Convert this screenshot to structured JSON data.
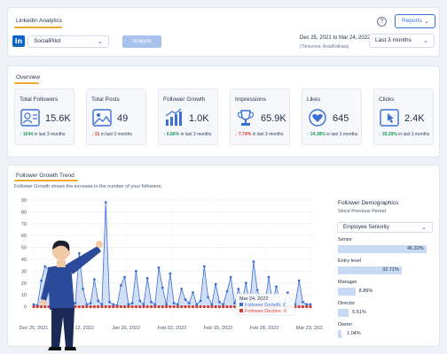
{
  "header": {
    "title": "LinkedIn Analytics",
    "account": "SocialPilot",
    "analyze_label": "Analyze",
    "date_range": "Dec 25, 2021 to Mar 24, 2022",
    "timezone": "(Timezone: Asia/Kolkata)",
    "period": "Last 3 months",
    "help": "?",
    "reports_label": "Reports"
  },
  "overview": {
    "title": "Overview",
    "metrics": [
      {
        "label": "Total Followers",
        "value": "15.6K",
        "change": "1044",
        "direction": "up",
        "suffix": "in last 3 months",
        "icon": "followers-icon"
      },
      {
        "label": "Total Posts",
        "value": "49",
        "change": "31",
        "direction": "down",
        "suffix": "in last 3 months",
        "icon": "image-icon"
      },
      {
        "label": "Follower Growth",
        "value": "1.0K",
        "change": "6.86%",
        "direction": "up",
        "suffix": "in last 3 months",
        "icon": "growth-icon"
      },
      {
        "label": "Impressions",
        "value": "65.9K",
        "change": "7.74%",
        "direction": "down",
        "suffix": "in last 3 months",
        "icon": "trophy-icon"
      },
      {
        "label": "Likes",
        "value": "645",
        "change": "34.38%",
        "direction": "up",
        "suffix": "in last 3 months",
        "icon": "heart-icon"
      },
      {
        "label": "Clicks",
        "value": "2.4K",
        "change": "39.29%",
        "direction": "up",
        "suffix": "in last 3 months",
        "icon": "click-icon"
      }
    ]
  },
  "trend": {
    "title": "Follower Growth Trend",
    "subtitle": "Follower Growth shows the increase in the number of your followers.",
    "tooltip": {
      "date": "Mar 24, 2022",
      "growth_label": "Follower Growth: 2",
      "decline_label": "Follower Decline: 0"
    }
  },
  "chart_data": {
    "type": "area",
    "x_ticks": [
      "Dec 25, 2021",
      "Jan 12, 2022",
      "Jan 26, 2022",
      "Feb 02, 2022",
      "Feb 15, 2022",
      "Feb 28, 2022",
      "Mar 23, 2022"
    ],
    "ylim": [
      -10,
      90
    ],
    "y_ticks": [
      0,
      10,
      20,
      30,
      40,
      50,
      60,
      70,
      80,
      90
    ],
    "grid": true,
    "series": [
      {
        "name": "Follower Growth",
        "color": "#3b6fd4",
        "values": [
          2,
          1,
          22,
          34,
          31,
          5,
          24,
          2,
          5,
          12,
          1,
          3,
          45,
          15,
          2,
          3,
          23,
          5,
          2,
          88,
          4,
          2,
          1,
          18,
          25,
          2,
          3,
          30,
          5,
          2,
          24,
          4,
          2,
          33,
          16,
          2,
          28,
          3,
          2,
          15,
          6,
          3,
          12,
          2,
          5,
          34,
          8,
          2,
          19,
          4,
          2,
          13,
          25,
          3,
          15,
          5,
          20,
          2,
          38,
          14,
          5,
          2,
          25,
          3,
          17,
          4,
          2,
          12,
          6,
          2,
          22,
          4,
          2,
          2
        ]
      },
      {
        "name": "Follower Decline",
        "color": "#d33a2c",
        "values": [
          0,
          0,
          0,
          0,
          0,
          0,
          0,
          0,
          0,
          0,
          0,
          0,
          0,
          0,
          0,
          0,
          0,
          0,
          0,
          0,
          0,
          0,
          0,
          0,
          0,
          0,
          0,
          0,
          0,
          0,
          0,
          0,
          0,
          0,
          0,
          0,
          0,
          0,
          0,
          0,
          0,
          0,
          0,
          0,
          0,
          0,
          0,
          0,
          0,
          0,
          0,
          0,
          0,
          0,
          0,
          0,
          0,
          0,
          0,
          0,
          0,
          0,
          0,
          0,
          0,
          0,
          0,
          0,
          0,
          0,
          0,
          0,
          0,
          0
        ]
      }
    ]
  },
  "demographics": {
    "title": "Follower Demographics",
    "subtitle": "Since Previous Period",
    "selected": "Employee Seniority",
    "rows": [
      {
        "label": "Senior",
        "value": "45.32%",
        "pct": 45.32
      },
      {
        "label": "Entry-level",
        "value": "32.71%",
        "pct": 32.71
      },
      {
        "label": "Manager",
        "value": "8.89%",
        "pct": 8.89
      },
      {
        "label": "Director",
        "value": "5.51%",
        "pct": 5.51
      },
      {
        "label": "Owner",
        "value": "1.04%",
        "pct": 1.04
      }
    ]
  },
  "colors": {
    "accent": "#3b6fd4",
    "underline": "#f0a92e",
    "up": "#1f9d55",
    "down": "#d33a2c"
  }
}
